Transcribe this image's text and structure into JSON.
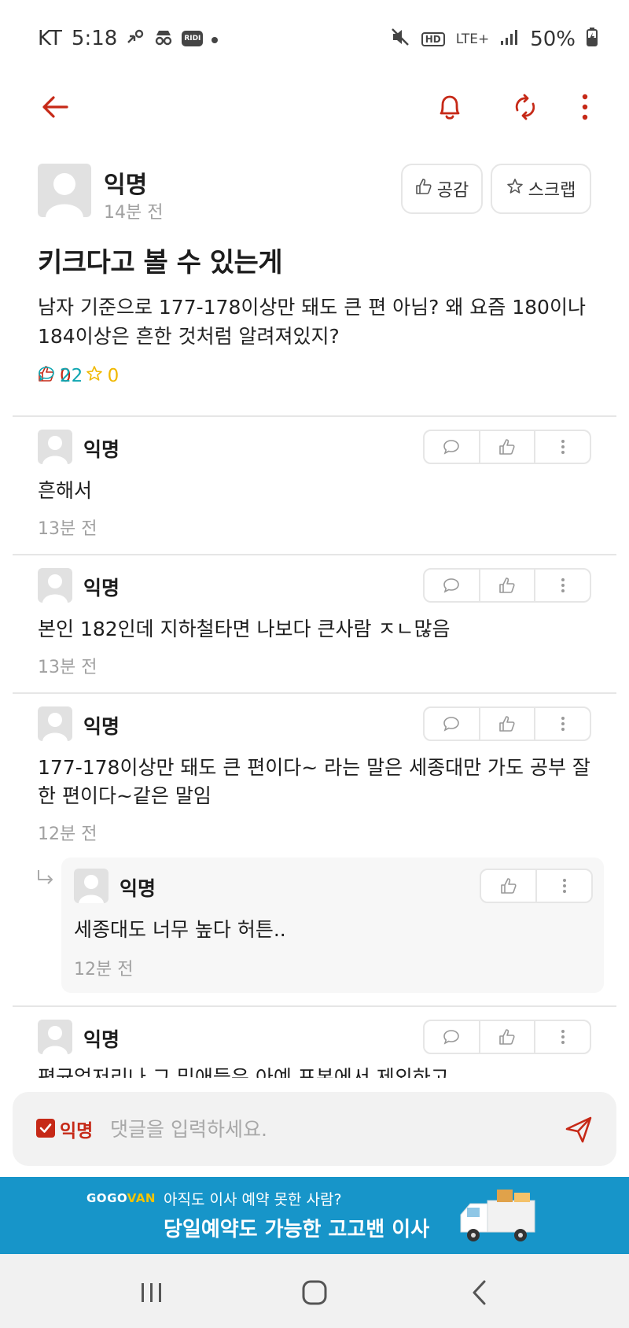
{
  "status_bar": {
    "carrier": "KT",
    "time": "5:18",
    "battery": "50%",
    "network": "LTE+",
    "hd_label": "HD",
    "ridi_label": "RIDI"
  },
  "colors": {
    "accent": "#c62917",
    "comment_count_color": "#0ca5b0",
    "scrap_color": "#f0b800",
    "ad_background": "#1795c9"
  },
  "post": {
    "author": "익명",
    "time": "14분 전",
    "like_button_label": "공감",
    "scrap_button_label": "스크랩",
    "title": "키크다고 볼 수 있는게",
    "body": "남자 기준으로 177-178이상만 돼도 큰 편 아님? 왜 요즘 180이나 184이상은 흔한 것처럼 알려져있지?",
    "likes": "0",
    "comments": "22",
    "scraps": "0"
  },
  "comments": [
    {
      "author": "익명",
      "text": "흔해서",
      "time": "13분 전"
    },
    {
      "author": "익명",
      "text": "본인 182인데 지하철타면 나보다 큰사람 ㅈㄴ많음",
      "time": "13분 전"
    },
    {
      "author": "익명",
      "text": "177-178이상만 돼도 큰 편이다~ 라는 말은 세종대만 가도 공부 잘한 편이다~같은 말임",
      "time": "12분 전"
    },
    {
      "author": "익명",
      "text": "평균얼저리나 그 밑애들은 아예 표본에서 제외하고",
      "time": ""
    }
  ],
  "reply": {
    "author": "익명",
    "text": "세종대도 너무 높다 허튼..",
    "time": "12분 전"
  },
  "input_bar": {
    "anonymous_label": "익명",
    "placeholder": "댓글을 입력하세요."
  },
  "ad": {
    "brand_left": "GOGO",
    "brand_right": "VAN",
    "line1": "아직도 이사 예약 못한 사람?",
    "line2": "당일예약도 가능한 고고밴 이사"
  }
}
